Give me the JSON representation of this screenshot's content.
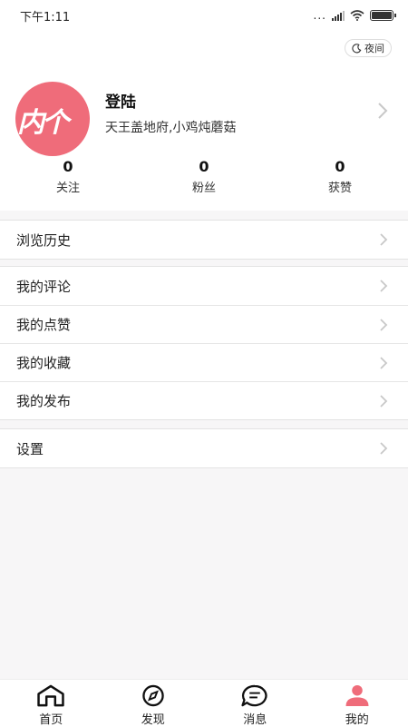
{
  "status_bar": {
    "time": "下午1:11",
    "dots": "...",
    "battery_level": 1.0
  },
  "header": {
    "night_label": "夜间",
    "avatar_text": "内个",
    "user_name": "登陆",
    "user_sub": "天王盖地府,小鸡炖蘑菇",
    "stats": [
      {
        "num": "0",
        "label": "关注"
      },
      {
        "num": "0",
        "label": "粉丝"
      },
      {
        "num": "0",
        "label": "获赞"
      }
    ]
  },
  "menu": {
    "history": "浏览历史",
    "comments": "我的评论",
    "likes": "我的点赞",
    "favorites": "我的收藏",
    "posts": "我的发布",
    "settings": "设置"
  },
  "tabs": [
    {
      "label": "首页",
      "icon": "home-icon"
    },
    {
      "label": "发现",
      "icon": "compass-icon"
    },
    {
      "label": "消息",
      "icon": "message-icon"
    },
    {
      "label": "我的",
      "icon": "user-icon",
      "active": true
    }
  ],
  "colors": {
    "accent": "#ef6c7a",
    "background": "#f7f6f7"
  }
}
